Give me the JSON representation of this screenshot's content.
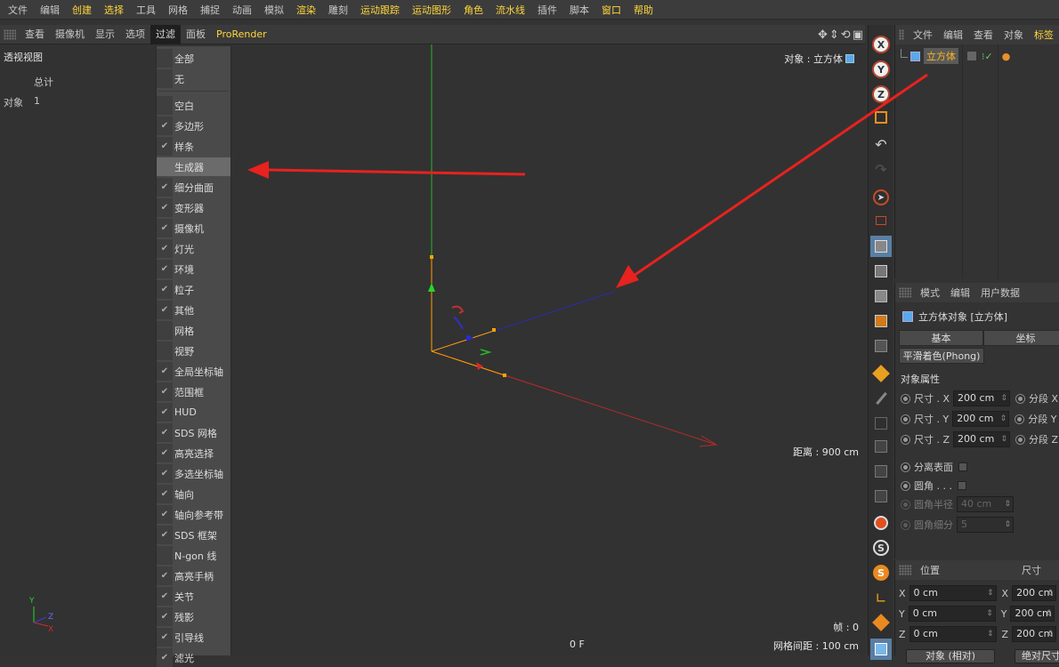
{
  "menubar": {
    "items": [
      "文件",
      "编辑",
      "创建",
      "选择",
      "工具",
      "网格",
      "捕捉",
      "动画",
      "模拟",
      "渲染",
      "雕刻",
      "运动跟踪",
      "运动图形",
      "角色",
      "流水线",
      "插件",
      "脚本",
      "窗口",
      "帮助"
    ],
    "highlighted": [
      "创建",
      "选择",
      "渲染",
      "运动跟踪",
      "运动图形",
      "角色",
      "流水线",
      "窗口",
      "帮助"
    ]
  },
  "viewport_toolbar": {
    "items": [
      "查看",
      "摄像机",
      "显示",
      "选项",
      "过滤",
      "面板",
      "ProRender"
    ],
    "active": "过滤"
  },
  "viewport": {
    "title": "透视视图",
    "total_label": "总计",
    "object_label": "对象",
    "object_count": "1",
    "current_object": "对象 : 立方体",
    "distance": "距离 : 900 cm",
    "frame": "帧 : 0",
    "grid_spacing": "网格间距 : 100 cm",
    "frame_f": "0 F",
    "mini_axes": {
      "x": "X",
      "y": "Y",
      "z": "Z"
    }
  },
  "filter_menu": {
    "items": [
      {
        "label": "全部",
        "checked": false
      },
      {
        "label": "无",
        "checked": false
      },
      {
        "label": "空白",
        "checked": false
      },
      {
        "label": "多边形",
        "checked": true
      },
      {
        "label": "样条",
        "checked": true
      },
      {
        "label": "生成器",
        "checked": false,
        "highlighted": true
      },
      {
        "label": "细分曲面",
        "checked": true
      },
      {
        "label": "变形器",
        "checked": true
      },
      {
        "label": "摄像机",
        "checked": true
      },
      {
        "label": "灯光",
        "checked": true
      },
      {
        "label": "环境",
        "checked": true
      },
      {
        "label": "粒子",
        "checked": true
      },
      {
        "label": "其他",
        "checked": true
      },
      {
        "label": "网格",
        "checked": false
      },
      {
        "label": "视野",
        "checked": false
      },
      {
        "label": "全局坐标轴",
        "checked": true
      },
      {
        "label": "范围框",
        "checked": true
      },
      {
        "label": "HUD",
        "checked": true
      },
      {
        "label": "SDS 网格",
        "checked": true
      },
      {
        "label": "高亮选择",
        "checked": true
      },
      {
        "label": "多选坐标轴",
        "checked": true
      },
      {
        "label": "轴向",
        "checked": true
      },
      {
        "label": "轴向参考带",
        "checked": true
      },
      {
        "label": "SDS 框架",
        "checked": true
      },
      {
        "label": "N-gon 线",
        "checked": false
      },
      {
        "label": "高亮手柄",
        "checked": true
      },
      {
        "label": "关节",
        "checked": true
      },
      {
        "label": "残影",
        "checked": true
      },
      {
        "label": "引导线",
        "checked": true
      },
      {
        "label": "滤光",
        "checked": true
      }
    ]
  },
  "right_toolbar": {
    "buttons": [
      "x-axis-lock-icon",
      "y-axis-lock-icon",
      "z-axis-lock-icon",
      "coordinate-system-icon",
      "undo-icon",
      "redo-icon",
      "live-selection-icon",
      "rectangle-selection-icon",
      "model-mode-icon",
      "object-mode-icon",
      "point-mode-icon",
      "edge-mode-icon",
      "polygon-mode-icon",
      "uv-mode-icon",
      "sculpt-icon",
      "knife-icon",
      "bevel-icon",
      "extrude-icon",
      "bridge-icon",
      "slide-icon",
      "magnet-icon",
      "snap-icon",
      "snap-settings-icon",
      "workplane-icon",
      "lock-workplane-icon",
      "cube-icon"
    ]
  },
  "object_manager": {
    "menu": [
      "文件",
      "编辑",
      "查看",
      "对象",
      "标签"
    ],
    "objects": [
      {
        "name": "立方体"
      }
    ]
  },
  "attribute_manager": {
    "menu": [
      "模式",
      "编辑",
      "用户数据"
    ],
    "title": "立方体对象 [立方体]",
    "tabs": [
      "基本",
      "坐标"
    ],
    "tab2": "平滑着色(Phong)",
    "section": "对象属性",
    "rows": [
      {
        "label": "尺寸 . X",
        "value": "200 cm",
        "seg": "分段 X"
      },
      {
        "label": "尺寸 . Y",
        "value": "200 cm",
        "seg": "分段 Y"
      },
      {
        "label": "尺寸 . Z",
        "value": "200 cm",
        "seg": "分段 Z"
      }
    ],
    "separate_surfaces": "分离表面",
    "fillet": "圆角 . . .",
    "fillet_radius_label": "圆角半径",
    "fillet_radius": "40 cm",
    "fillet_subdiv_label": "圆角细分",
    "fillet_subdiv": "5"
  },
  "coordinate_manager": {
    "position_label": "位置",
    "size_label": "尺寸",
    "rows": [
      {
        "axis": "X",
        "pos": "0 cm",
        "size": "200 cm"
      },
      {
        "axis": "Y",
        "pos": "0 cm",
        "size": "200 cm"
      },
      {
        "axis": "Z",
        "pos": "0 cm",
        "size": "200 cm"
      }
    ],
    "object_rel_button": "对象 (相对)",
    "abs_size_button": "绝对尺寸"
  },
  "colors": {
    "accent": "#ffd73a",
    "annotation_arrow": "#e8221e",
    "axis_y": "#2bb52b",
    "axis_x": "#c0392b",
    "axis_z": "#2a2ab4"
  }
}
